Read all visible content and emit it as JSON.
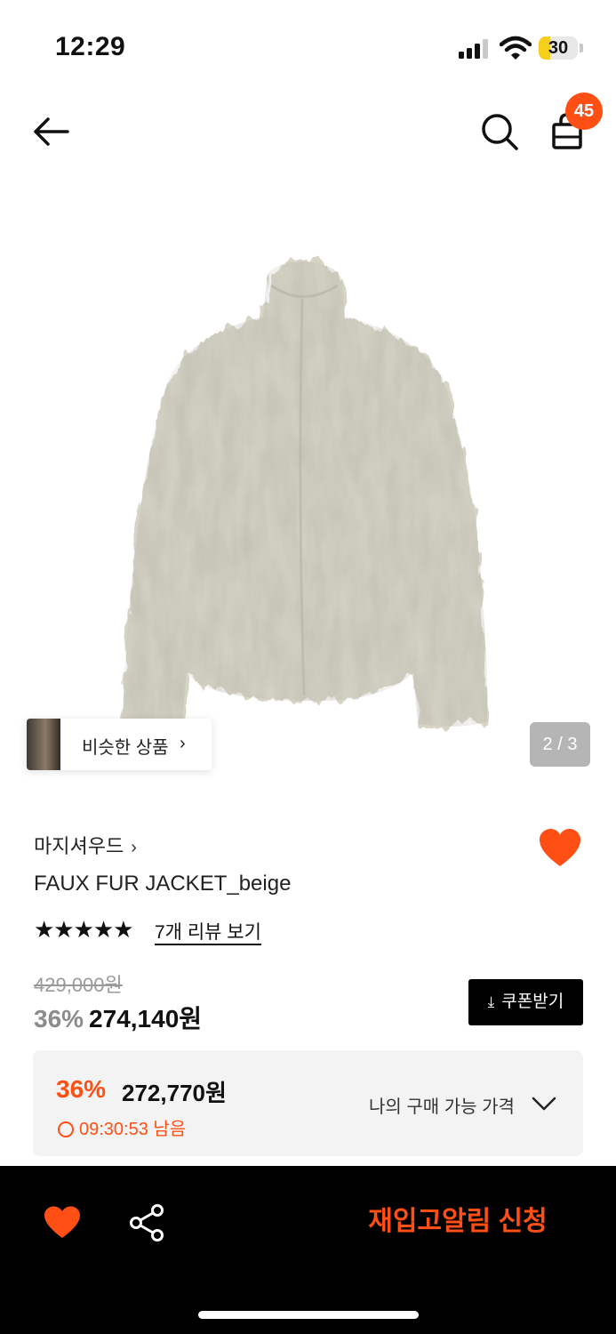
{
  "status_bar": {
    "time": "12:29",
    "battery_level": "30",
    "battery_fill_fraction": 0.3,
    "battery_color": "#f6cf1b"
  },
  "header": {
    "back_icon": "arrow-left-icon",
    "search_icon": "search-icon",
    "cart_icon": "shopping-bag-icon",
    "cart_count": "45",
    "badge_color": "#ff4f14"
  },
  "gallery": {
    "image_subject": "beige faux fur jacket",
    "similar_label": "비슷한 상품",
    "page_indicator": "2 / 3"
  },
  "product": {
    "brand": "마지셔우드",
    "name": "FAUX FUR JACKET_beige",
    "rating_stars": 5,
    "review_link": "7개 리뷰 보기",
    "original_price": "429,000원",
    "discount": "36%",
    "sale_price": "274,140원",
    "coupon_label": "쿠폰받기",
    "wishlisted": true,
    "accent_color": "#ff4f14"
  },
  "my_price": {
    "discount": "36%",
    "price": "272,770원",
    "timer": "09:30:53 남음",
    "label": "나의 구매 가능 가격"
  },
  "bottom_bar": {
    "restock_label": "재입고알림 신청",
    "wish_icon": "heart-icon",
    "share_icon": "share-icon"
  }
}
